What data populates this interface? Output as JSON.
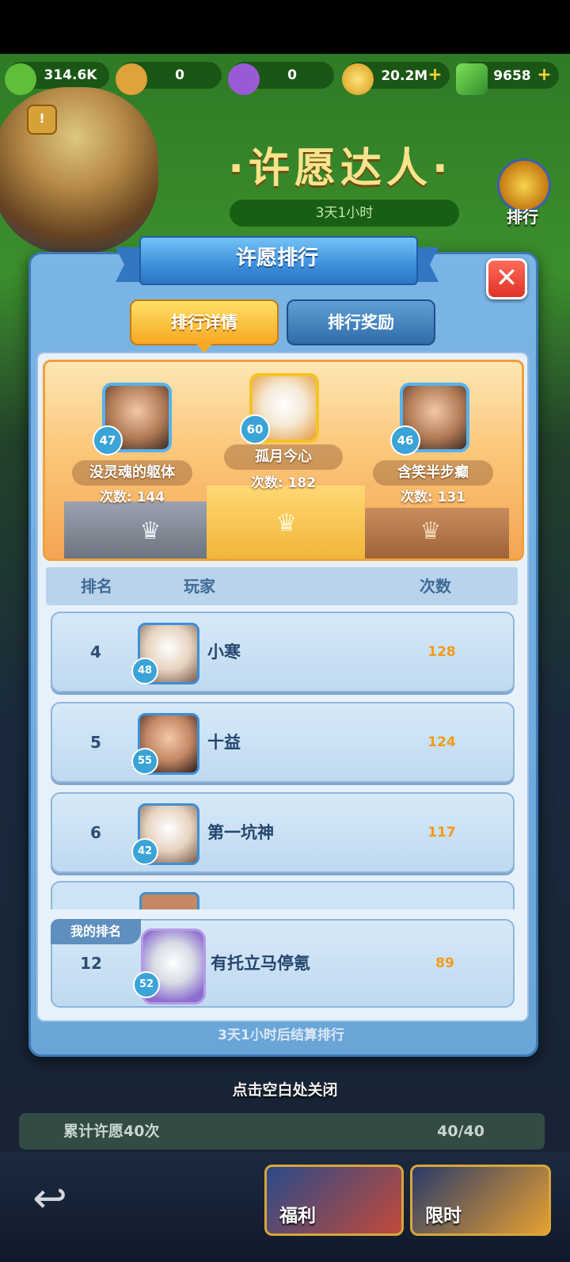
{
  "resources": [
    {
      "icon": "green-cash-icon",
      "value": "314.6K",
      "plus": false
    },
    {
      "icon": "scroll-icon",
      "value": "0",
      "plus": false
    },
    {
      "icon": "purple-scroll-icon",
      "value": "0",
      "plus": false
    },
    {
      "icon": "gold-coin-icon",
      "value": "20.2M",
      "plus": true
    },
    {
      "icon": "gem-icon",
      "value": "9658",
      "plus": true
    }
  ],
  "event": {
    "title": "·许愿达人·",
    "time_left": "3天1小时",
    "side_button": "排行"
  },
  "modal": {
    "title": "许愿排行",
    "tabs": {
      "active": "排行详情",
      "inactive": "排行奖励"
    },
    "podium": [
      {
        "place": "1",
        "name": "孤月今心",
        "level": "60",
        "count_text": "次数: 182"
      },
      {
        "place": "2",
        "name": "没灵魂的躯体",
        "level": "47",
        "count_text": "次数: 144"
      },
      {
        "place": "3",
        "name": "含笑半步癫",
        "level": "46",
        "count_text": "次数: 131"
      }
    ],
    "columns": {
      "rank": "排名",
      "player": "玩家",
      "count": "次数"
    },
    "rows": [
      {
        "rank": "4",
        "level": "48",
        "name": "小寒",
        "count": "128"
      },
      {
        "rank": "5",
        "level": "55",
        "name": "十益",
        "count": "124"
      },
      {
        "rank": "6",
        "level": "42",
        "name": "第一坑神",
        "count": "117"
      }
    ],
    "my_rank": {
      "label": "我的排名",
      "rank": "12",
      "level": "52",
      "name": "有托立马停氪",
      "count": "89"
    },
    "footer": "3天1小时后结算排行"
  },
  "close_hint": "点击空白处关闭",
  "task": {
    "label": "累计许愿40次",
    "progress": "40/40"
  },
  "bottom": {
    "welfare": "福利",
    "limited": "限时"
  },
  "colors": {
    "accent_gold": "#f7a823",
    "panel_blue": "#6aa5d8",
    "count_orange": "#f29b1a"
  }
}
